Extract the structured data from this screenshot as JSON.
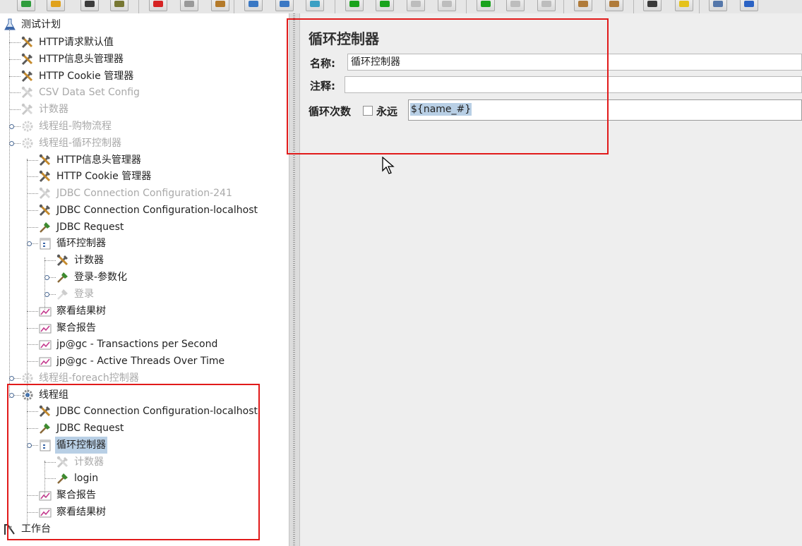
{
  "toolbar": {
    "buttons": [
      {
        "icon": "open-icon",
        "color": "#2f9c3c"
      },
      {
        "icon": "folder-icon",
        "color": "#e0a21c"
      },
      {
        "icon": "save-icon",
        "color": "#3c3c3c"
      },
      {
        "icon": "save-as-icon",
        "color": "#777733"
      },
      {
        "icon": "cut-icon",
        "color": "#d62323"
      },
      {
        "icon": "copy-icon",
        "color": "#999999"
      },
      {
        "icon": "paste-icon",
        "color": "#b47a2a"
      },
      {
        "icon": "expand-icon",
        "color": "#3a78c4"
      },
      {
        "icon": "collapse-icon",
        "color": "#3a78c4"
      },
      {
        "icon": "toggle-icon",
        "color": "#3aa0c4"
      },
      {
        "icon": "start-icon",
        "color": "#19a31c"
      },
      {
        "icon": "start-no-pauses-icon",
        "color": "#19a31c"
      },
      {
        "icon": "stop-icon",
        "color": "#bdbdbd"
      },
      {
        "icon": "shutdown-icon",
        "color": "#bdbdbd"
      },
      {
        "icon": "remote-start-icon",
        "color": "#19a31c"
      },
      {
        "icon": "remote-stop-icon",
        "color": "#bdbdbd"
      },
      {
        "icon": "remote-exit-icon",
        "color": "#bdbdbd"
      },
      {
        "icon": "clear-icon",
        "color": "#b07b3a"
      },
      {
        "icon": "clear-all-icon",
        "color": "#b07b3a"
      },
      {
        "icon": "search-icon",
        "color": "#3a3a3a"
      },
      {
        "icon": "reset-search-icon",
        "color": "#e5c21a"
      },
      {
        "icon": "function-helper-icon",
        "color": "#5577aa"
      },
      {
        "icon": "help-icon",
        "color": "#2a62c4"
      }
    ]
  },
  "tree": {
    "nodes": [
      {
        "label": "测试计划",
        "icon": "test-plan-icon",
        "depth": 0,
        "disabled": false,
        "selected": false,
        "toggle": "none"
      },
      {
        "label": "HTTP请求默认值",
        "icon": "config-element-icon",
        "depth": 1,
        "disabled": false,
        "selected": false,
        "toggle": "none"
      },
      {
        "label": "HTTP信息头管理器",
        "icon": "config-element-icon",
        "depth": 1,
        "disabled": false,
        "selected": false,
        "toggle": "none"
      },
      {
        "label": "HTTP Cookie 管理器",
        "icon": "config-element-icon",
        "depth": 1,
        "disabled": false,
        "selected": false,
        "toggle": "none"
      },
      {
        "label": "CSV Data Set Config",
        "icon": "config-element-icon",
        "depth": 1,
        "disabled": true,
        "selected": false,
        "toggle": "none"
      },
      {
        "label": "计数器",
        "icon": "config-element-icon",
        "depth": 1,
        "disabled": true,
        "selected": false,
        "toggle": "none"
      },
      {
        "label": "线程组-购物流程",
        "icon": "thread-group-icon",
        "depth": 1,
        "disabled": true,
        "selected": false,
        "toggle": "collapsed"
      },
      {
        "label": "线程组-循环控制器",
        "icon": "thread-group-icon",
        "depth": 1,
        "disabled": true,
        "selected": false,
        "toggle": "expanded"
      },
      {
        "label": "HTTP信息头管理器",
        "icon": "config-element-icon",
        "depth": 2,
        "disabled": false,
        "selected": false,
        "toggle": "none"
      },
      {
        "label": "HTTP Cookie 管理器",
        "icon": "config-element-icon",
        "depth": 2,
        "disabled": false,
        "selected": false,
        "toggle": "none"
      },
      {
        "label": "JDBC Connection Configuration-241",
        "icon": "config-element-icon",
        "depth": 2,
        "disabled": true,
        "selected": false,
        "toggle": "none"
      },
      {
        "label": "JDBC Connection Configuration-localhost",
        "icon": "config-element-icon",
        "depth": 2,
        "disabled": false,
        "selected": false,
        "toggle": "none"
      },
      {
        "label": "JDBC Request",
        "icon": "sampler-icon",
        "depth": 2,
        "disabled": false,
        "selected": false,
        "toggle": "none"
      },
      {
        "label": "循环控制器",
        "icon": "loop-controller-icon",
        "depth": 2,
        "disabled": false,
        "selected": false,
        "toggle": "expanded"
      },
      {
        "label": "计数器",
        "icon": "config-element-icon",
        "depth": 3,
        "disabled": false,
        "selected": false,
        "toggle": "none"
      },
      {
        "label": "登录-参数化",
        "icon": "sampler-icon",
        "depth": 3,
        "disabled": false,
        "selected": false,
        "toggle": "collapsed"
      },
      {
        "label": "登录",
        "icon": "sampler-icon",
        "depth": 3,
        "disabled": true,
        "selected": false,
        "toggle": "collapsed"
      },
      {
        "label": "察看结果树",
        "icon": "listener-icon",
        "depth": 2,
        "disabled": false,
        "selected": false,
        "toggle": "none"
      },
      {
        "label": "聚合报告",
        "icon": "listener-icon",
        "depth": 2,
        "disabled": false,
        "selected": false,
        "toggle": "none"
      },
      {
        "label": "jp@gc - Transactions per Second",
        "icon": "listener-icon",
        "depth": 2,
        "disabled": false,
        "selected": false,
        "toggle": "none"
      },
      {
        "label": "jp@gc - Active Threads Over Time",
        "icon": "listener-icon",
        "depth": 2,
        "disabled": false,
        "selected": false,
        "toggle": "none"
      },
      {
        "label": "线程组-foreach控制器",
        "icon": "thread-group-icon",
        "depth": 1,
        "disabled": true,
        "selected": false,
        "toggle": "collapsed"
      },
      {
        "label": "线程组",
        "icon": "thread-group-icon",
        "depth": 1,
        "disabled": false,
        "selected": false,
        "toggle": "expanded"
      },
      {
        "label": "JDBC Connection Configuration-localhost",
        "icon": "config-element-icon",
        "depth": 2,
        "disabled": false,
        "selected": false,
        "toggle": "none"
      },
      {
        "label": "JDBC Request",
        "icon": "sampler-icon",
        "depth": 2,
        "disabled": false,
        "selected": false,
        "toggle": "none"
      },
      {
        "label": "循环控制器",
        "icon": "loop-controller-icon",
        "depth": 2,
        "disabled": false,
        "selected": true,
        "toggle": "expanded"
      },
      {
        "label": "计数器",
        "icon": "config-element-icon",
        "depth": 3,
        "disabled": true,
        "selected": false,
        "toggle": "none"
      },
      {
        "label": "login",
        "icon": "sampler-icon",
        "depth": 3,
        "disabled": false,
        "selected": false,
        "toggle": "none"
      },
      {
        "label": "聚合报告",
        "icon": "listener-icon",
        "depth": 2,
        "disabled": false,
        "selected": false,
        "toggle": "none"
      },
      {
        "label": "察看结果树",
        "icon": "listener-icon",
        "depth": 2,
        "disabled": false,
        "selected": false,
        "toggle": "none"
      },
      {
        "label": "工作台",
        "icon": "workbench-icon",
        "depth": 0,
        "disabled": false,
        "selected": false,
        "toggle": "none"
      }
    ]
  },
  "editor": {
    "title": "循环控制器",
    "name_label": "名称:",
    "name_value": "循环控制器",
    "comment_label": "注释:",
    "comment_value": "",
    "loop_count_label": "循环次数",
    "forever_label": "永远",
    "forever_checked": false,
    "loop_count_value": "${name_#}"
  },
  "colors": {
    "highlight_box": "#e11a1a",
    "selection": "#b8cfe5",
    "disabled_text": "#a9a9a9"
  }
}
